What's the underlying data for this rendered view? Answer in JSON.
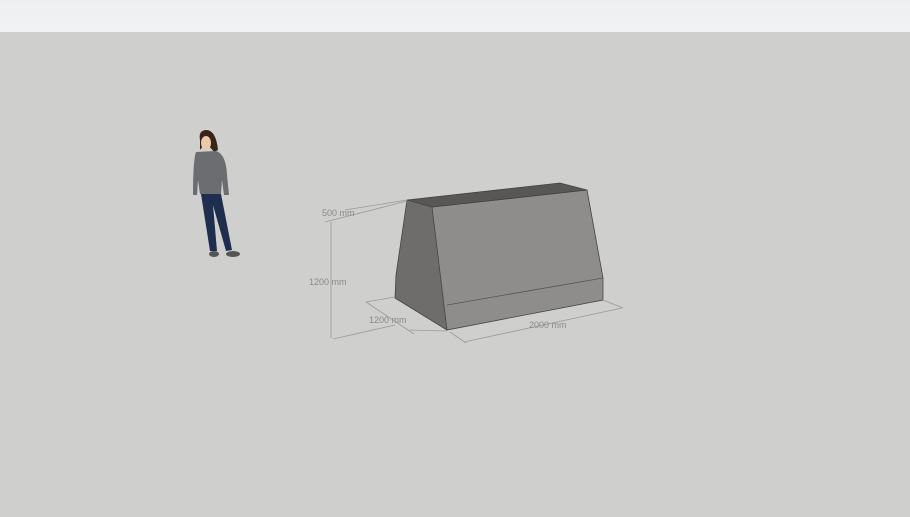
{
  "scene": {
    "dimensions": {
      "top_depth": "500 mm",
      "height": "1200 mm",
      "base_depth": "1200 mm",
      "length": "2000 mm"
    }
  },
  "colors": {
    "background": "#cfcfcd",
    "topbar": "#eff0f2",
    "front_face": "#8d8b8a",
    "side_face": "#6e6c6b",
    "top_face": "#575655"
  }
}
